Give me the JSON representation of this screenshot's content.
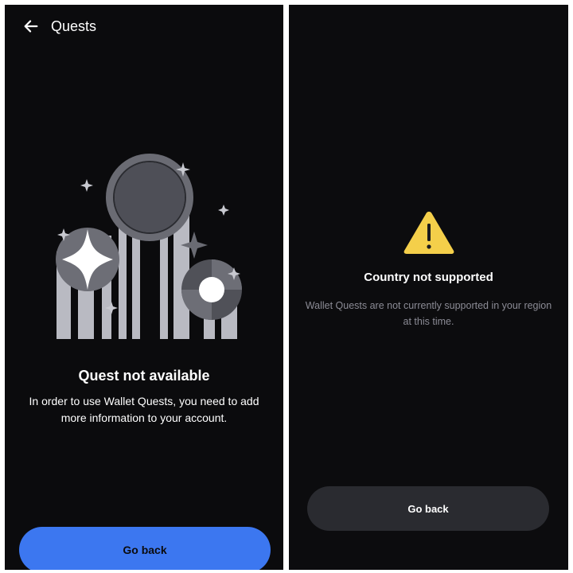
{
  "left_screen": {
    "header": {
      "title": "Quests",
      "back_icon": "arrow-left-icon"
    },
    "illustration_icon": "quest-illustration",
    "title": "Quest not available",
    "description": "In order to use Wallet Quests, you need to add more information to your account.",
    "button_label": "Go back",
    "colors": {
      "background": "#0b0b0d",
      "accent": "#3c77f0"
    }
  },
  "right_screen": {
    "warning_icon": "warning-triangle-icon",
    "title": "Country not supported",
    "description": "Wallet Quests are not currently supported in your region at this time.",
    "button_label": "Go back",
    "colors": {
      "background": "#0c0c0e",
      "warning": "#f4cf4a",
      "button": "#2a2b30"
    }
  }
}
